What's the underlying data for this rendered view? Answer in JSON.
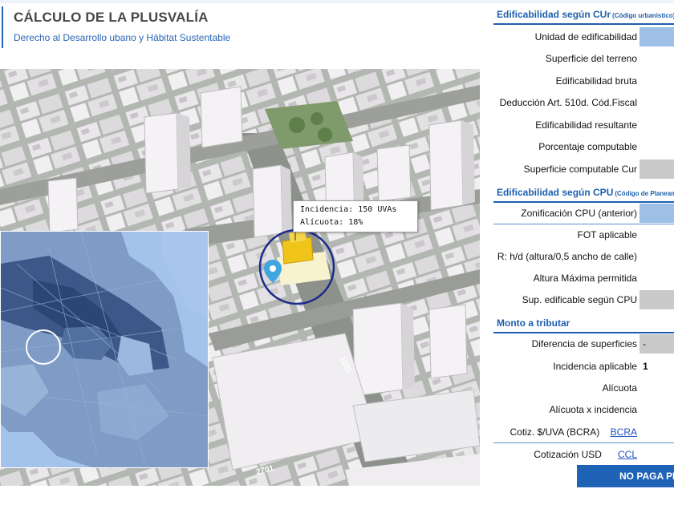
{
  "header": {
    "title": "CÁLCULO DE LA PLUSVALÍA",
    "subtitle": "Derecho al Desarrollo ubano y Hábitat Sustentable"
  },
  "map": {
    "tooltip": {
      "line1": "Incidencia: 150 UVAs",
      "line2": "Alícuota: 18%"
    },
    "street_labels": [
      "1101",
      "2701"
    ],
    "marker_icon": "map-pin-icon",
    "accent_colors": {
      "highlight_building": "#f0c419",
      "marker": "#41a6e0",
      "ring": "#1b2a8a"
    }
  },
  "panel": {
    "section_cur": {
      "title": "Edificabilidad según CUr",
      "note": "(Código urbanistico)",
      "rows": [
        {
          "label": "Unidad de edificabilidad",
          "value": ""
        },
        {
          "label": "Superficie del terreno",
          "value": ""
        },
        {
          "label": "Edificabilidad bruta",
          "value": ""
        },
        {
          "label": "Deducción Art. 510d. Cód.Fiscal",
          "value": ""
        },
        {
          "label": "Edificabilidad resultante",
          "value": ""
        },
        {
          "label": "Porcentaje computable",
          "value": ""
        },
        {
          "label": "Superficie computable Cur",
          "value": ""
        }
      ]
    },
    "section_cpu": {
      "title": "Edificabilidad según CPU",
      "note": "(Código de Planeam.",
      "rows": [
        {
          "label": "Zonificación CPU (anterior)",
          "value": ""
        },
        {
          "label": "FOT aplicable",
          "value": ""
        },
        {
          "label": "R: h/d (altura/0,5 ancho de calle)",
          "value": ""
        },
        {
          "label": "Altura Máxima permitida",
          "value": ""
        },
        {
          "label": "Sup. edificable según CPU",
          "value": ""
        }
      ]
    },
    "section_monto": {
      "title": "Monto a tributar",
      "rows": [
        {
          "label": "Diferencia de superficies",
          "value": "-"
        },
        {
          "label": "Incidencia aplicable",
          "value": "1"
        },
        {
          "label": "Alícuota",
          "value": ""
        },
        {
          "label": "Alícuota x incidencia",
          "value": ""
        },
        {
          "label": "Cotiz. $/UVA (BCRA)",
          "link": "BCRA",
          "value": ""
        },
        {
          "label": "Cotización USD",
          "link": "CCL",
          "value": ""
        }
      ]
    },
    "result": "NO PAGA PL"
  }
}
